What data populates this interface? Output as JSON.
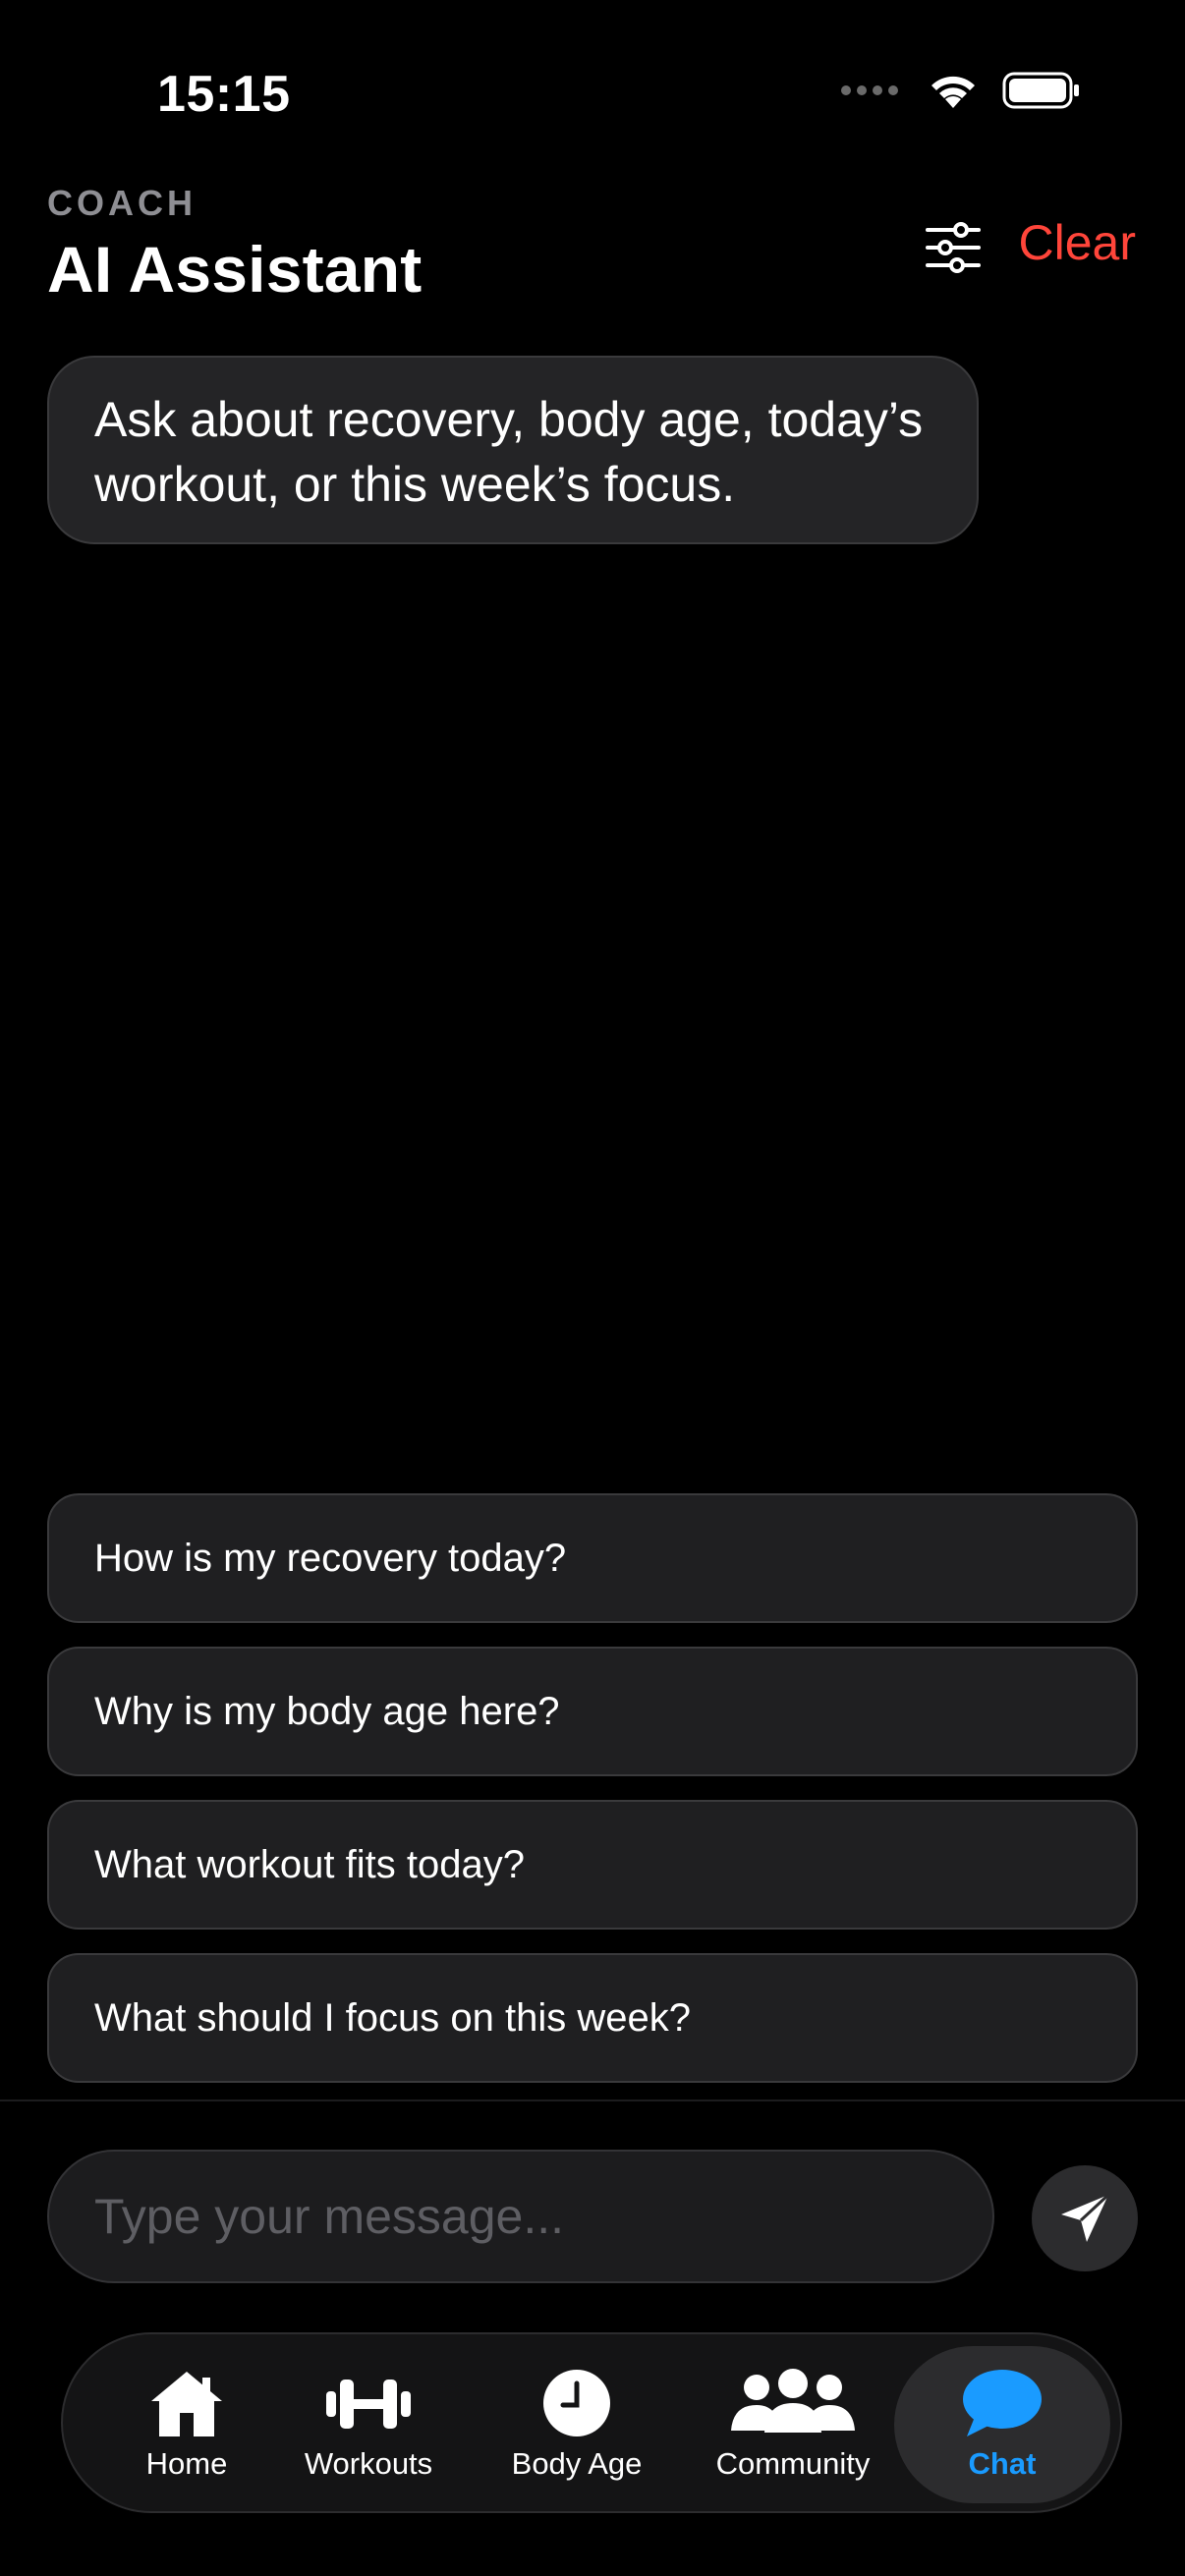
{
  "status_bar": {
    "time": "15:15"
  },
  "header": {
    "eyebrow": "COACH",
    "title": "AI Assistant",
    "clear_label": "Clear"
  },
  "welcome_message": "Ask about recovery, body age, today’s workout, or this week’s focus.",
  "suggestions": [
    "How is my recovery today?",
    "Why is my body age here?",
    "What workout fits today?",
    "What should I focus on this week?"
  ],
  "composer": {
    "placeholder": "Type your message..."
  },
  "tabs": [
    {
      "label": "Home",
      "icon": "house-icon"
    },
    {
      "label": "Workouts",
      "icon": "dumbbell-icon"
    },
    {
      "label": "Body Age",
      "icon": "clock-icon"
    },
    {
      "label": "Community",
      "icon": "people-icon"
    },
    {
      "label": "Chat",
      "icon": "chat-bubble-icon",
      "active": true
    }
  ],
  "colors": {
    "background": "#000000",
    "accent_red": "#ff453a",
    "accent_blue": "#1a9bff",
    "bubble": "#242426"
  }
}
